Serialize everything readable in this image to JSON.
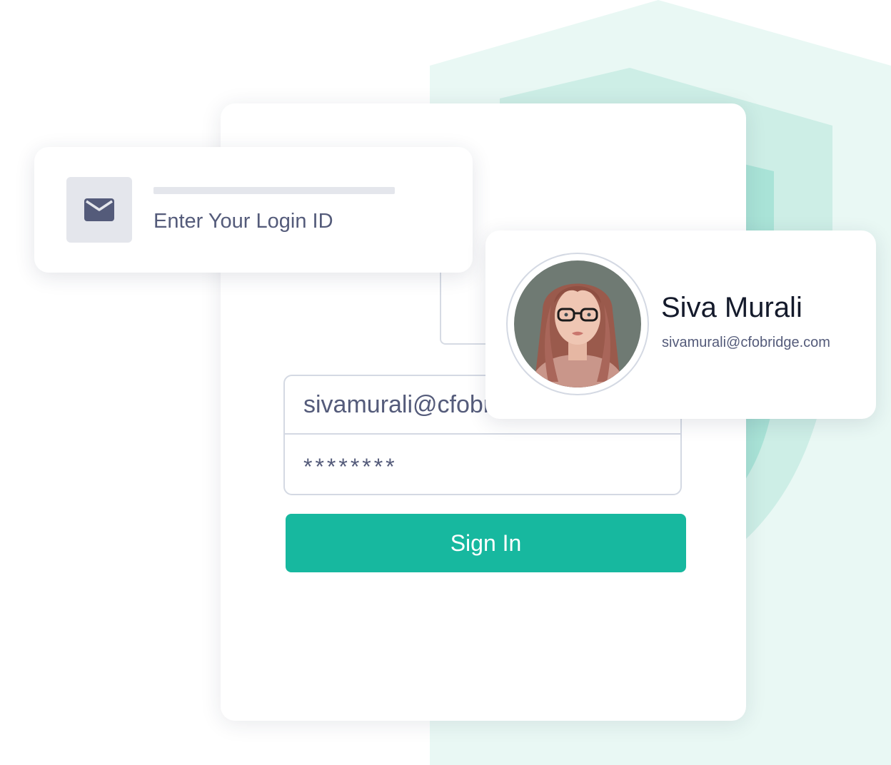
{
  "login_card": {
    "icon": "envelope-icon",
    "label": "Enter Your Login ID"
  },
  "form": {
    "email_value": "sivamurali@cfobridge.com",
    "password_value": "********",
    "submit_label": "Sign In"
  },
  "profile": {
    "name": "Siva Murali",
    "email": "sivamurali@cfobridge.com",
    "avatar": "avatar-photo"
  },
  "colors": {
    "accent": "#17b89f",
    "shield_light": "#e9f8f4",
    "shield_mid": "#cdeee6",
    "shield_dark": "#a9e3d7",
    "text_primary": "#141a2b",
    "text_secondary": "#545b7a",
    "border": "#d4d9e3"
  }
}
